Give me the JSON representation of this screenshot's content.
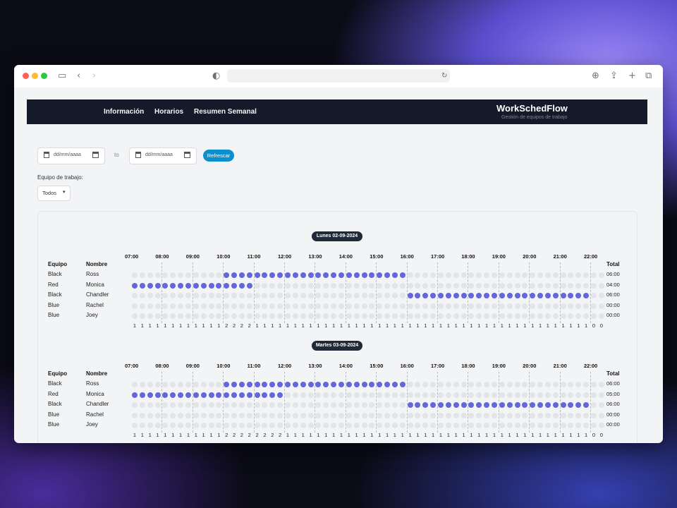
{
  "brand": {
    "title": "WorkSchedFlow",
    "subtitle": "Gestión de equipos de trabajo"
  },
  "nav": [
    "Información",
    "Horarios",
    "Resumen Semanal"
  ],
  "filters": {
    "date_from_placeholder": "dd/mm/aaaa",
    "to_label": "to",
    "date_to_placeholder": "dd/mm/aaaa",
    "refresh_label": "Refrescar",
    "team_label": "Equipo de trabajo:",
    "team_selected": "Todos"
  },
  "schedule": {
    "hours": [
      "07:00",
      "08:00",
      "09:00",
      "10:00",
      "11:00",
      "12:00",
      "13:00",
      "14:00",
      "15:00",
      "16:00",
      "17:00",
      "18:00",
      "19:00",
      "20:00",
      "21:00",
      "22:00"
    ],
    "headers": {
      "team": "Equipo",
      "name": "Nombre",
      "total": "Total"
    },
    "days": [
      {
        "label": "Lunes 02-09-2024",
        "rows": [
          {
            "team": "Black",
            "name": "Ross",
            "start": 12,
            "end": 36,
            "total": "06:00"
          },
          {
            "team": "Red",
            "name": "Monica",
            "start": 0,
            "end": 16,
            "total": "04:00"
          },
          {
            "team": "Black",
            "name": "Chandler",
            "start": 36,
            "end": 60,
            "total": "06:00"
          },
          {
            "team": "Blue",
            "name": "Rachel",
            "start": 0,
            "end": 0,
            "total": "00:00"
          },
          {
            "team": "Blue",
            "name": "Joey",
            "start": 0,
            "end": 0,
            "total": "00:00"
          }
        ],
        "counts": [
          1,
          1,
          1,
          1,
          1,
          1,
          1,
          1,
          1,
          1,
          1,
          1,
          2,
          2,
          2,
          2,
          1,
          1,
          1,
          1,
          1,
          1,
          1,
          1,
          1,
          1,
          1,
          1,
          1,
          1,
          1,
          1,
          1,
          1,
          1,
          1,
          1,
          1,
          1,
          1,
          1,
          1,
          1,
          1,
          1,
          1,
          1,
          1,
          1,
          1,
          1,
          1,
          1,
          1,
          1,
          1,
          1,
          1,
          1,
          1,
          0,
          0
        ]
      },
      {
        "label": "Martes 03-09-2024",
        "rows": [
          {
            "team": "Black",
            "name": "Ross",
            "start": 12,
            "end": 36,
            "total": "06:00"
          },
          {
            "team": "Red",
            "name": "Monica",
            "start": 0,
            "end": 20,
            "total": "05:00"
          },
          {
            "team": "Black",
            "name": "Chandler",
            "start": 36,
            "end": 60,
            "total": "06:00"
          },
          {
            "team": "Blue",
            "name": "Rachel",
            "start": 0,
            "end": 0,
            "total": "00:00"
          },
          {
            "team": "Blue",
            "name": "Joey",
            "start": 0,
            "end": 0,
            "total": "00:00"
          }
        ],
        "counts": [
          1,
          1,
          1,
          1,
          1,
          1,
          1,
          1,
          1,
          1,
          1,
          1,
          2,
          2,
          2,
          2,
          2,
          2,
          2,
          2,
          1,
          1,
          1,
          1,
          1,
          1,
          1,
          1,
          1,
          1,
          1,
          1,
          1,
          1,
          1,
          1,
          1,
          1,
          1,
          1,
          1,
          1,
          1,
          1,
          1,
          1,
          1,
          1,
          1,
          1,
          1,
          1,
          1,
          1,
          1,
          1,
          1,
          1,
          1,
          1,
          0,
          0
        ]
      }
    ]
  }
}
